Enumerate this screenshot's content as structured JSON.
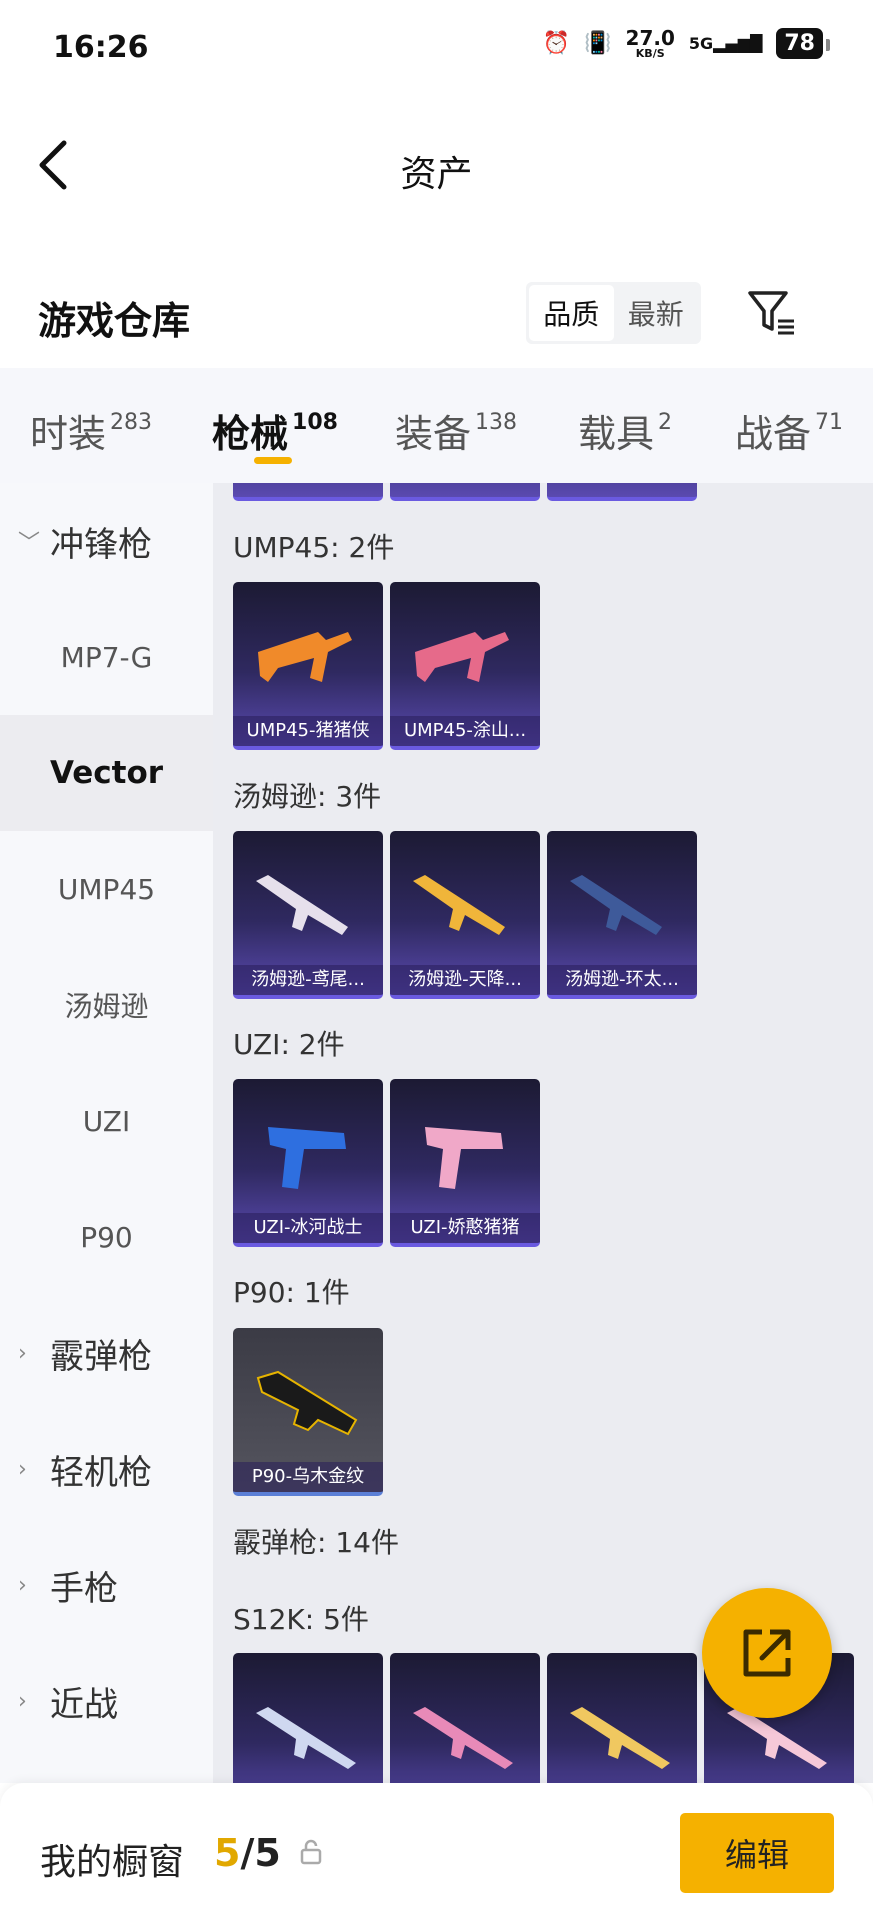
{
  "status_bar": {
    "time": "16:26",
    "net_speed": "27.0",
    "net_unit": "KB/S",
    "network": "5G",
    "battery": "78"
  },
  "nav": {
    "title": "资产"
  },
  "library": {
    "title": "游戏仓库",
    "sort_options": [
      "品质",
      "最新"
    ],
    "sort_active": "品质"
  },
  "categories": [
    {
      "label": "时装",
      "count": "283"
    },
    {
      "label": "枪械",
      "count": "108",
      "active": true
    },
    {
      "label": "装备",
      "count": "138"
    },
    {
      "label": "载具",
      "count": "2"
    },
    {
      "label": "战备",
      "count": "71"
    }
  ],
  "sidebar": {
    "items": [
      {
        "label": "冲锋枪",
        "type": "group",
        "expanded": true
      },
      {
        "label": "MP7-G",
        "type": "sub"
      },
      {
        "label": "Vector",
        "type": "sub",
        "active": true
      },
      {
        "label": "UMP45",
        "type": "sub"
      },
      {
        "label": "汤姆逊",
        "type": "sub"
      },
      {
        "label": "UZI",
        "type": "sub"
      },
      {
        "label": "P90",
        "type": "sub"
      },
      {
        "label": "霰弹枪",
        "type": "group"
      },
      {
        "label": "轻机枪",
        "type": "group"
      },
      {
        "label": "手枪",
        "type": "group"
      },
      {
        "label": "近战",
        "type": "group"
      }
    ]
  },
  "content": {
    "sections": [
      {
        "title": "UMP45: 2件",
        "items": [
          "UMP45-猪猪侠",
          "UMP45-涂山..."
        ]
      },
      {
        "title": "汤姆逊: 3件",
        "items": [
          "汤姆逊-鸢尾...",
          "汤姆逊-天降...",
          "汤姆逊-环太..."
        ]
      },
      {
        "title": "UZI: 2件",
        "items": [
          "UZI-冰河战士",
          "UZI-娇憨猪猪"
        ]
      },
      {
        "title": "P90: 1件",
        "items": [
          "P90-乌木金纹"
        ]
      },
      {
        "title": "霰弹枪: 14件",
        "items": []
      },
      {
        "title": "S12K: 5件",
        "items": []
      }
    ]
  },
  "bottom_bar": {
    "title": "我的橱窗",
    "current": "5",
    "total": "/5",
    "edit_label": "编辑"
  },
  "colors": {
    "accent": "#f5b100",
    "card_purple": "#2f2960",
    "card_grey": "#55555f"
  }
}
